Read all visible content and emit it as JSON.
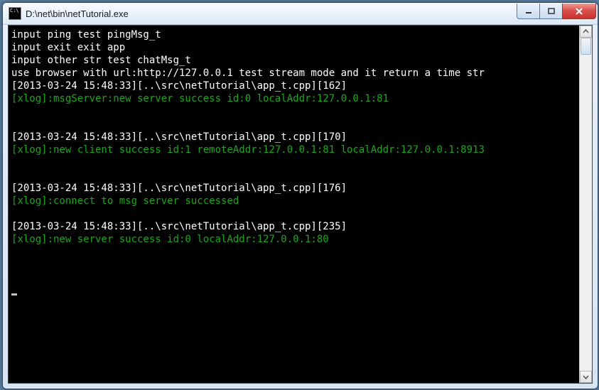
{
  "window": {
    "title": "D:\\net\\bin\\netTutorial.exe"
  },
  "console": {
    "lines": [
      {
        "text": "input ping test pingMsg_t",
        "cls": ""
      },
      {
        "text": "input exit exit app",
        "cls": ""
      },
      {
        "text": "input other str test chatMsg_t",
        "cls": ""
      },
      {
        "text": "use browser with url:http://127.0.0.1 test stream mode and it return a time str",
        "cls": ""
      },
      {
        "text": "[2013-03-24 15:48:33][..\\src\\netTutorial\\app_t.cpp][162]",
        "cls": ""
      },
      {
        "text": "[xlog]:msgServer:new server success id:0 localAddr:127.0.0.1:81",
        "cls": "green"
      },
      {
        "text": "",
        "cls": ""
      },
      {
        "text": "",
        "cls": ""
      },
      {
        "text": "[2013-03-24 15:48:33][..\\src\\netTutorial\\app_t.cpp][170]",
        "cls": ""
      },
      {
        "text": "[xlog]:new client success id:1 remoteAddr:127.0.0.1:81 localAddr:127.0.0.1:8913",
        "cls": "green"
      },
      {
        "text": "",
        "cls": ""
      },
      {
        "text": "",
        "cls": ""
      },
      {
        "text": "[2013-03-24 15:48:33][..\\src\\netTutorial\\app_t.cpp][176]",
        "cls": ""
      },
      {
        "text": "[xlog]:connect to msg server successed",
        "cls": "green"
      },
      {
        "text": "",
        "cls": ""
      },
      {
        "text": "[2013-03-24 15:48:33][..\\src\\netTutorial\\app_t.cpp][235]",
        "cls": ""
      },
      {
        "text": "[xlog]:new server success id:0 localAddr:127.0.0.1:80",
        "cls": "green"
      },
      {
        "text": "",
        "cls": ""
      },
      {
        "text": "",
        "cls": ""
      },
      {
        "text": "",
        "cls": ""
      }
    ]
  }
}
